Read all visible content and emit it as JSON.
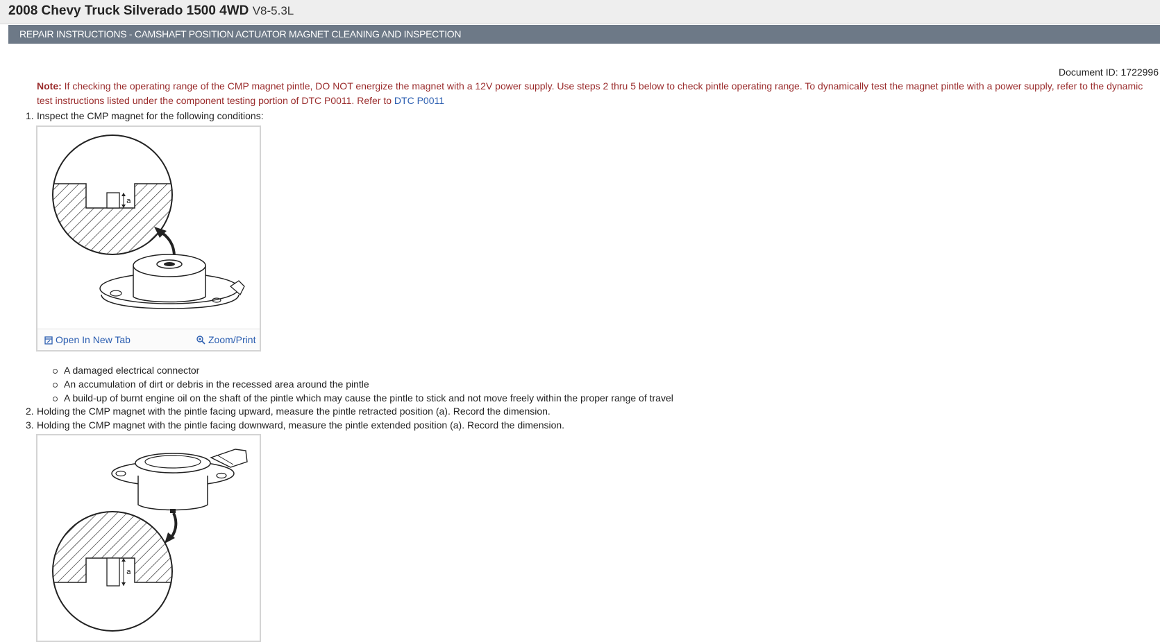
{
  "vehicle": {
    "model": "2008 Chevy Truck Silverado 1500 4WD",
    "engine": "V8-5.3L"
  },
  "section_title": "REPAIR INSTRUCTIONS - CAMSHAFT POSITION ACTUATOR MAGNET CLEANING AND INSPECTION",
  "document_id": "Document ID: 1722996",
  "note": {
    "label": "Note:",
    "text": "If checking the operating range of the CMP magnet pintle, DO NOT energize the magnet with a 12V power supply. Use steps 2 thru 5 below to check pintle operating range. To dynamically test the magnet pintle with a power supply, refer to the dynamic test instructions listed under the component testing portion of DTC P0011. Refer to",
    "link": "DTC P0011"
  },
  "steps": [
    {
      "num": "1.",
      "text": "Inspect the CMP magnet for the following conditions:"
    },
    {
      "num": "2.",
      "text": "Holding the CMP magnet with the pintle facing upward, measure the pintle retracted position (a). Record the dimension."
    },
    {
      "num": "3.",
      "text": "Holding the CMP magnet with the pintle facing downward, measure the pintle extended position (a). Record the dimension."
    }
  ],
  "conditions": [
    "A damaged electrical connector",
    "An accumulation of dirt or debris in the recessed area around the pintle",
    "A build-up of burnt engine oil on the shaft of the pintle which may cause the pintle to stick and not move freely within the proper range of travel"
  ],
  "figure_actions": {
    "open_new_tab": "Open In New Tab",
    "zoom_print": "Zoom/Print"
  },
  "figure_labels": {
    "dimension": "a"
  },
  "colors": {
    "header_band": "#6d7987",
    "note_text": "#9a2b2b",
    "link": "#2a5db0"
  }
}
